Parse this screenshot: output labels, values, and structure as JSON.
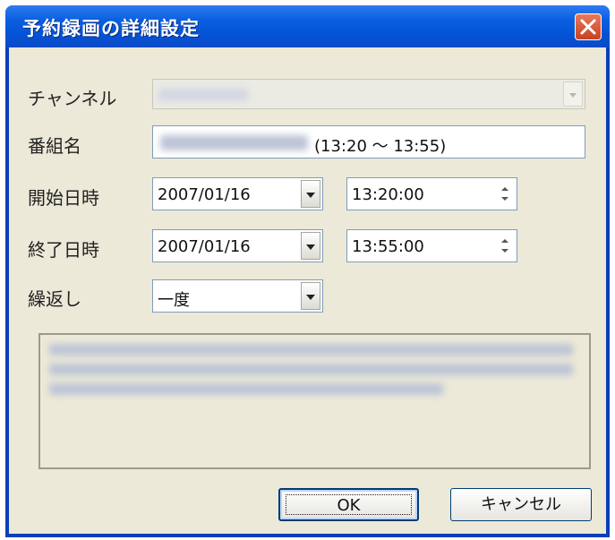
{
  "window": {
    "title": "予約録画の詳細設定"
  },
  "fields": {
    "channel": {
      "label": "チャンネル",
      "value": ""
    },
    "program_name": {
      "label": "番組名",
      "time_suffix": "(13:20 ～ 13:55)"
    },
    "start": {
      "label": "開始日時",
      "date": "2007/01/16",
      "time": "13:20:00"
    },
    "end": {
      "label": "終了日時",
      "date": "2007/01/16",
      "time": "13:55:00"
    },
    "repeat": {
      "label": "繰返し",
      "selected": "一度"
    }
  },
  "buttons": {
    "ok": "OK",
    "cancel": "キャンセル"
  },
  "colors": {
    "titlebar": "#0a5fe0",
    "dialog_bg": "#ece9d8",
    "close_button": "#c9411f"
  }
}
